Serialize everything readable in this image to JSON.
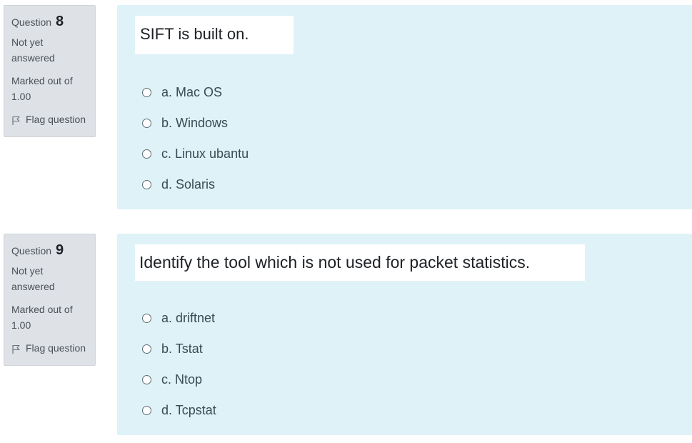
{
  "questions": [
    {
      "number_label": "Question",
      "number": "8",
      "state": "Not yet answered",
      "grade": "Marked out of 1.00",
      "flag_label": "Flag question",
      "text": "SIFT is built on.",
      "options": [
        {
          "label": "a. Mac OS"
        },
        {
          "label": "b. Windows"
        },
        {
          "label": "c. Linux ubantu"
        },
        {
          "label": "d. Solaris"
        }
      ]
    },
    {
      "number_label": "Question",
      "number": "9",
      "state": "Not yet answered",
      "grade": "Marked out of 1.00",
      "flag_label": "Flag question",
      "text": "Identify the tool which is not used for packet statistics.",
      "options": [
        {
          "label": "a. driftnet"
        },
        {
          "label": "b. Tstat"
        },
        {
          "label": "c. Ntop"
        },
        {
          "label": "d. Tcpstat"
        }
      ]
    }
  ],
  "colors": {
    "info_bg": "#dee2e6",
    "content_bg": "#def2f8",
    "text": "#1d2125"
  },
  "icons": {
    "flag": "flag-icon",
    "radio": "radio-unchecked-icon"
  }
}
